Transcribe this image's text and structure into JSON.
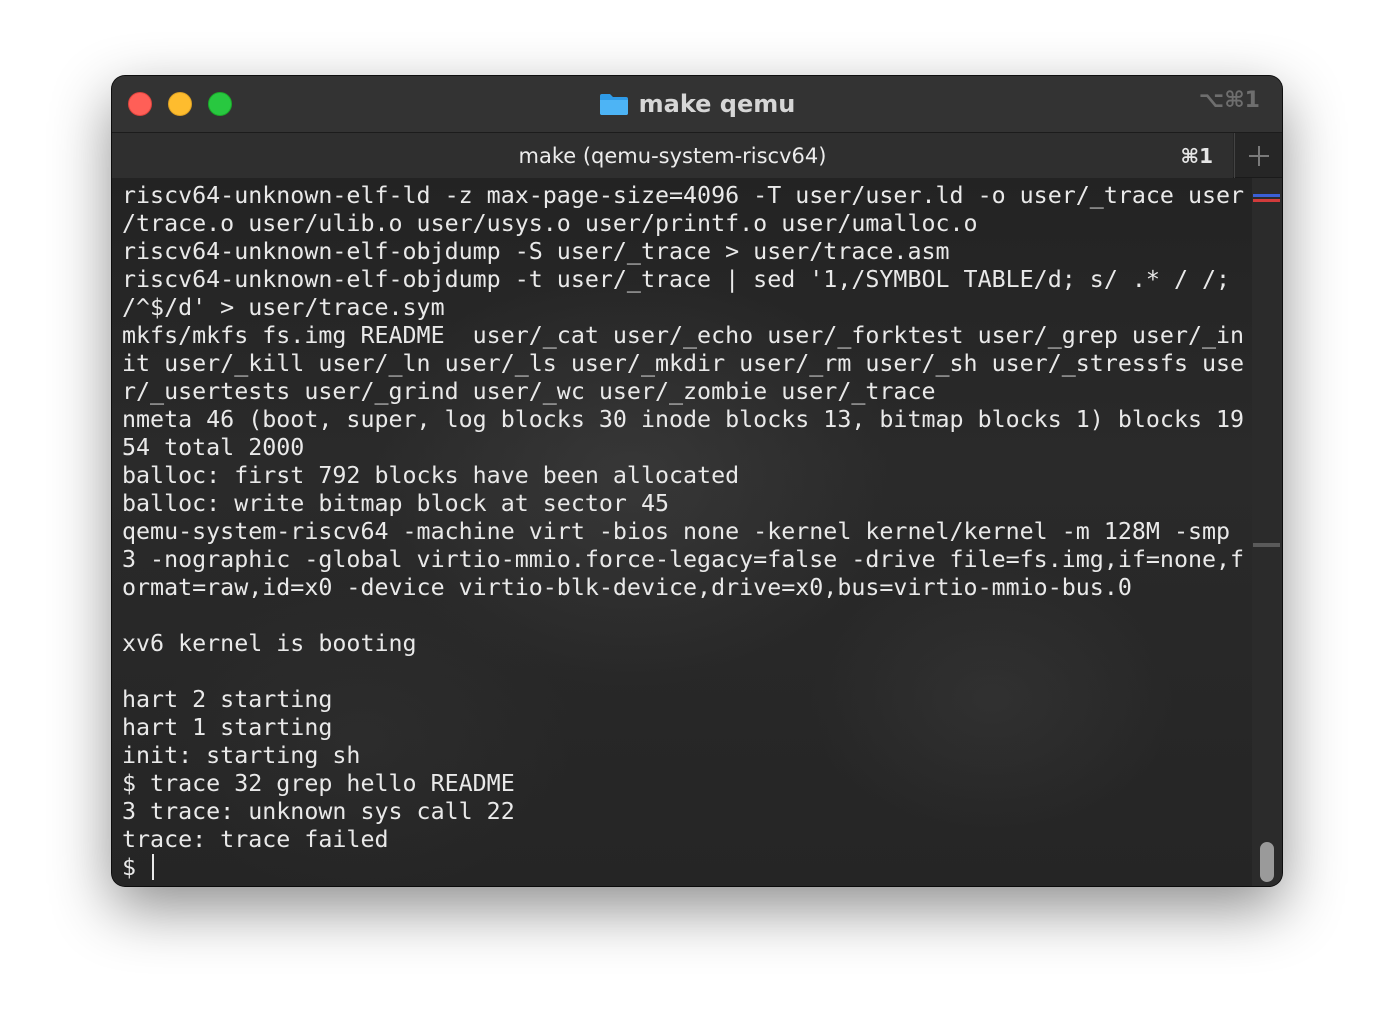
{
  "window": {
    "title": "make qemu",
    "title_shortcut": "⌥⌘1",
    "folder_icon": "folder-icon",
    "accent_colors": {
      "close": "#ff5f57",
      "minimize": "#febc2e",
      "maximize": "#28c840"
    }
  },
  "tabs": [
    {
      "label": "make (qemu-system-riscv64)",
      "shortcut": "⌘1"
    }
  ],
  "new_tab_icon": "plus-icon",
  "terminal": {
    "lines": [
      "riscv64-unknown-elf-ld -z max-page-size=4096 -T user/user.ld -o user/_trace user",
      "/trace.o user/ulib.o user/usys.o user/printf.o user/umalloc.o",
      "riscv64-unknown-elf-objdump -S user/_trace > user/trace.asm",
      "riscv64-unknown-elf-objdump -t user/_trace | sed '1,/SYMBOL TABLE/d; s/ .* / /;",
      "/^$/d' > user/trace.sym",
      "mkfs/mkfs fs.img README  user/_cat user/_echo user/_forktest user/_grep user/_in",
      "it user/_kill user/_ln user/_ls user/_mkdir user/_rm user/_sh user/_stressfs use",
      "r/_usertests user/_grind user/_wc user/_zombie user/_trace",
      "nmeta 46 (boot, super, log blocks 30 inode blocks 13, bitmap blocks 1) blocks 19",
      "54 total 2000",
      "balloc: first 792 blocks have been allocated",
      "balloc: write bitmap block at sector 45",
      "qemu-system-riscv64 -machine virt -bios none -kernel kernel/kernel -m 128M -smp",
      "3 -nographic -global virtio-mmio.force-legacy=false -drive file=fs.img,if=none,f",
      "ormat=raw,id=x0 -device virtio-blk-device,drive=x0,bus=virtio-mmio-bus.0",
      "",
      "xv6 kernel is booting",
      "",
      "hart 2 starting",
      "hart 1 starting",
      "init: starting sh",
      "$ trace 32 grep hello README",
      "3 trace: unknown sys call 22",
      "trace: trace failed"
    ],
    "prompt": "$ "
  }
}
